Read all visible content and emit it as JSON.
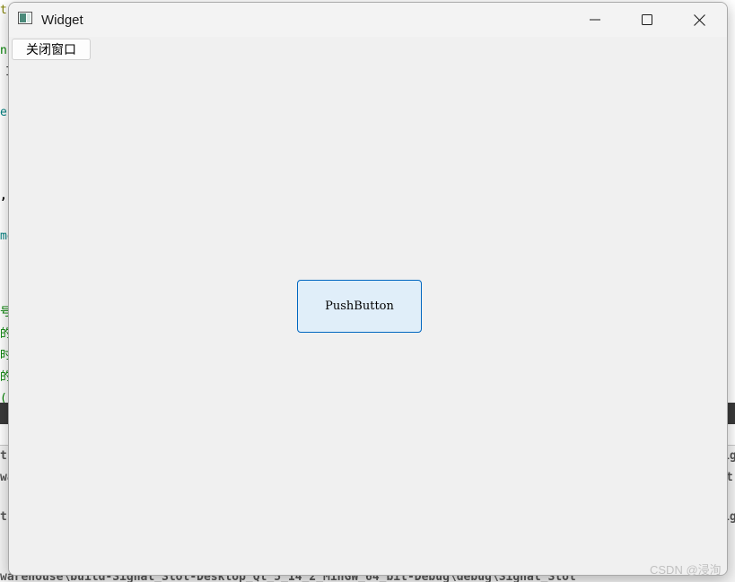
{
  "background": {
    "code_fragments": [
      {
        "text": "t",
        "color": "#808000"
      },
      {
        "text": "nE",
        "color": "#008000"
      },
      {
        "text": "I",
        "color": "#333333"
      },
      {
        "text": "e:",
        "color": "#008080"
      },
      {
        "text": ",\"",
        "color": "#000000"
      },
      {
        "text": "me",
        "color": "#008080"
      },
      {
        "text": "号",
        "color": "#008000"
      },
      {
        "text": "的",
        "color": "#008000"
      },
      {
        "text": "时",
        "color": "#008000"
      },
      {
        "text": "的",
        "color": "#008000"
      },
      {
        "text": "(i",
        "color": "#008000"
      }
    ],
    "right_fragments": [
      "ig",
      "t",
      "ig"
    ],
    "output_lines": [
      "t(",
      "wa",
      "t(",
      "warehouse\\build-Signal_Slot-Desktop_Qt_5_14_2_MinGW_64_bit-Debug\\debug\\Signal_Slot"
    ]
  },
  "window": {
    "title": "Widget",
    "icon": "qt-window-icon",
    "controls": {
      "minimize": "minimize-icon",
      "maximize": "maximize-icon",
      "close": "close-icon"
    },
    "close_window_button_label": "关闭窗口",
    "push_button_label": "PushButton"
  },
  "watermark": "CSDN @浸洵",
  "colors": {
    "push_button_border": "#0067c0",
    "push_button_fill": "#e0eef9",
    "client_background": "#f0f0f0"
  }
}
